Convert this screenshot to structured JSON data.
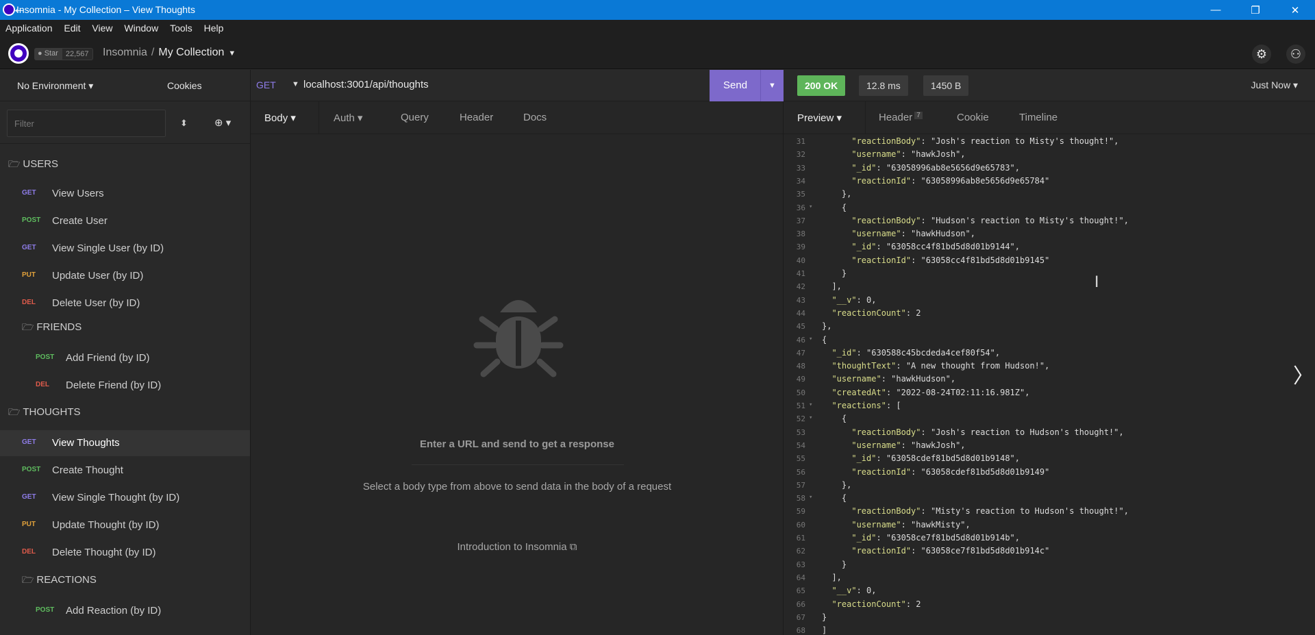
{
  "window": {
    "title": "Insomnia - My Collection – View Thoughts",
    "minimize": "—",
    "maximize": "❐",
    "close": "✕"
  },
  "menu": [
    "Application",
    "Edit",
    "View",
    "Window",
    "Tools",
    "Help"
  ],
  "header": {
    "github_star": "Star",
    "github_count": "22,567",
    "crumb_root": "Insomnia",
    "crumb_sep": "/",
    "crumb_current": "My Collection",
    "caret": "▼"
  },
  "sidebar": {
    "environment": "No Environment ▾",
    "cookies": "Cookies",
    "filter_placeholder": "Filter",
    "folders": {
      "users": "USERS",
      "friends": "FRIENDS",
      "thoughts": "THOUGHTS",
      "reactions": "REACTIONS"
    },
    "requests": [
      {
        "method": "GET",
        "label": "View Users"
      },
      {
        "method": "POST",
        "label": "Create User"
      },
      {
        "method": "GET",
        "label": "View Single User (by ID)"
      },
      {
        "method": "PUT",
        "label": "Update User (by ID)"
      },
      {
        "method": "DEL",
        "label": "Delete User (by ID)"
      },
      {
        "method": "POST",
        "label": "Add Friend (by ID)"
      },
      {
        "method": "DEL",
        "label": "Delete Friend (by ID)"
      },
      {
        "method": "GET",
        "label": "View Thoughts"
      },
      {
        "method": "POST",
        "label": "Create Thought"
      },
      {
        "method": "GET",
        "label": "View Single Thought (by ID)"
      },
      {
        "method": "PUT",
        "label": "Update Thought (by ID)"
      },
      {
        "method": "DEL",
        "label": "Delete Thought (by ID)"
      },
      {
        "method": "POST",
        "label": "Add Reaction (by ID)"
      }
    ]
  },
  "request": {
    "method": "GET",
    "url": "localhost:3001/api/thoughts",
    "send": "Send",
    "tabs": [
      "Body ▾",
      "Auth ▾",
      "Query",
      "Header",
      "Docs"
    ],
    "empty_title": "Enter a URL and send to get a response",
    "empty_sub": "Select a body type from above to send data in the body of a request",
    "intro_link": "Introduction to Insomnia"
  },
  "response": {
    "status": "200 OK",
    "time": "12.8 ms",
    "size": "1450 B",
    "when": "Just Now ▾",
    "tabs": [
      "Preview ▾",
      "Header",
      "Cookie",
      "Timeline"
    ],
    "header_count": "7",
    "lines": [
      {
        "no": "31",
        "fold": "",
        "text": "      \"reactionBody\": \"Josh's reaction to Misty's thought!\","
      },
      {
        "no": "32",
        "fold": "",
        "text": "      \"username\": \"hawkJosh\","
      },
      {
        "no": "33",
        "fold": "",
        "text": "      \"_id\": \"63058996ab8e5656d9e65783\","
      },
      {
        "no": "34",
        "fold": "",
        "text": "      \"reactionId\": \"63058996ab8e5656d9e65784\""
      },
      {
        "no": "35",
        "fold": "",
        "text": "    },"
      },
      {
        "no": "36",
        "fold": "▾",
        "text": "    {"
      },
      {
        "no": "37",
        "fold": "",
        "text": "      \"reactionBody\": \"Hudson's reaction to Misty's thought!\","
      },
      {
        "no": "38",
        "fold": "",
        "text": "      \"username\": \"hawkHudson\","
      },
      {
        "no": "39",
        "fold": "",
        "text": "      \"_id\": \"63058cc4f81bd5d8d01b9144\","
      },
      {
        "no": "40",
        "fold": "",
        "text": "      \"reactionId\": \"63058cc4f81bd5d8d01b9145\""
      },
      {
        "no": "41",
        "fold": "",
        "text": "    }"
      },
      {
        "no": "42",
        "fold": "",
        "text": "  ],"
      },
      {
        "no": "43",
        "fold": "",
        "text": "  \"__v\": 0,"
      },
      {
        "no": "44",
        "fold": "",
        "text": "  \"reactionCount\": 2"
      },
      {
        "no": "45",
        "fold": "",
        "text": "},"
      },
      {
        "no": "46",
        "fold": "▾",
        "text": "{"
      },
      {
        "no": "47",
        "fold": "",
        "text": "  \"_id\": \"630588c45bcdeda4cef80f54\","
      },
      {
        "no": "48",
        "fold": "",
        "text": "  \"thoughtText\": \"A new thought from Hudson!\","
      },
      {
        "no": "49",
        "fold": "",
        "text": "  \"username\": \"hawkHudson\","
      },
      {
        "no": "50",
        "fold": "",
        "text": "  \"createdAt\": \"2022-08-24T02:11:16.981Z\","
      },
      {
        "no": "51",
        "fold": "▾",
        "text": "  \"reactions\": ["
      },
      {
        "no": "52",
        "fold": "▾",
        "text": "    {"
      },
      {
        "no": "53",
        "fold": "",
        "text": "      \"reactionBody\": \"Josh's reaction to Hudson's thought!\","
      },
      {
        "no": "54",
        "fold": "",
        "text": "      \"username\": \"hawkJosh\","
      },
      {
        "no": "55",
        "fold": "",
        "text": "      \"_id\": \"63058cdef81bd5d8d01b9148\","
      },
      {
        "no": "56",
        "fold": "",
        "text": "      \"reactionId\": \"63058cdef81bd5d8d01b9149\""
      },
      {
        "no": "57",
        "fold": "",
        "text": "    },"
      },
      {
        "no": "58",
        "fold": "▾",
        "text": "    {"
      },
      {
        "no": "59",
        "fold": "",
        "text": "      \"reactionBody\": \"Misty's reaction to Hudson's thought!\","
      },
      {
        "no": "60",
        "fold": "",
        "text": "      \"username\": \"hawkMisty\","
      },
      {
        "no": "61",
        "fold": "",
        "text": "      \"_id\": \"63058ce7f81bd5d8d01b914b\","
      },
      {
        "no": "62",
        "fold": "",
        "text": "      \"reactionId\": \"63058ce7f81bd5d8d01b914c\""
      },
      {
        "no": "63",
        "fold": "",
        "text": "    }"
      },
      {
        "no": "64",
        "fold": "",
        "text": "  ],"
      },
      {
        "no": "65",
        "fold": "",
        "text": "  \"__v\": 0,"
      },
      {
        "no": "66",
        "fold": "",
        "text": "  \"reactionCount\": 2"
      },
      {
        "no": "67",
        "fold": "",
        "text": "}"
      },
      {
        "no": "68",
        "fold": "",
        "text": "]"
      }
    ]
  }
}
